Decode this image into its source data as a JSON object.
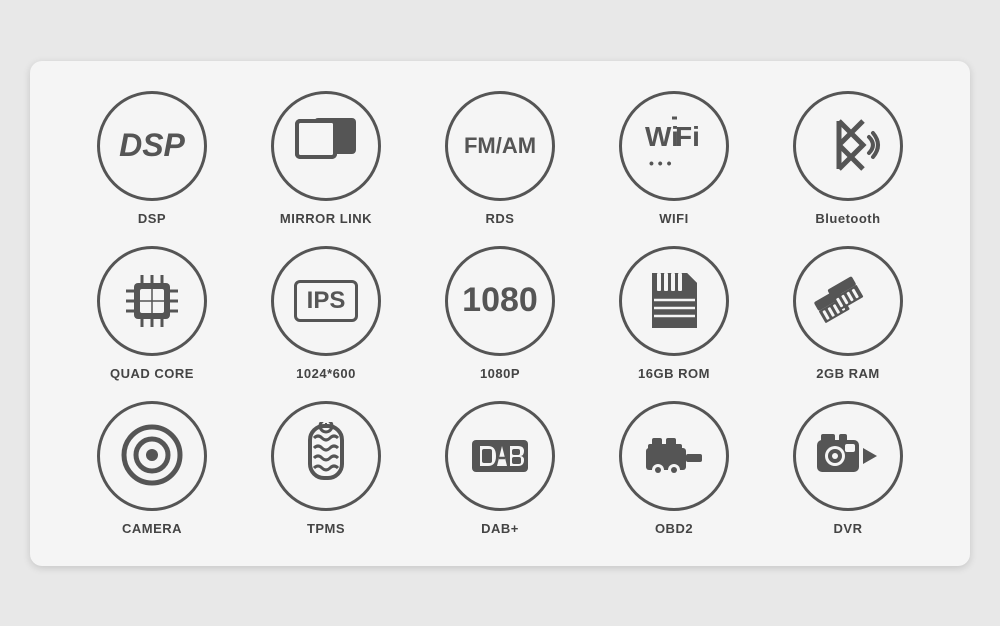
{
  "features": [
    {
      "id": "dsp",
      "label": "DSP",
      "row": 1
    },
    {
      "id": "mirror-link",
      "label": "MIRROR LINK",
      "row": 1
    },
    {
      "id": "rds",
      "label": "RDS",
      "row": 1
    },
    {
      "id": "wifi",
      "label": "WIFI",
      "row": 1
    },
    {
      "id": "bluetooth",
      "label": "Bluetooth",
      "row": 1
    },
    {
      "id": "quad-core",
      "label": "QUAD CORE",
      "row": 2
    },
    {
      "id": "ips",
      "label": "1024*600",
      "row": 2
    },
    {
      "id": "1080p",
      "label": "1080P",
      "row": 2
    },
    {
      "id": "16gb-rom",
      "label": "16GB ROM",
      "row": 2
    },
    {
      "id": "2gb-ram",
      "label": "2GB RAM",
      "row": 2
    },
    {
      "id": "camera",
      "label": "CAMERA",
      "row": 3
    },
    {
      "id": "tpms",
      "label": "TPMS",
      "row": 3
    },
    {
      "id": "dab",
      "label": "DAB+",
      "row": 3
    },
    {
      "id": "obd2",
      "label": "OBD2",
      "row": 3
    },
    {
      "id": "dvr",
      "label": "DVR",
      "row": 3
    }
  ]
}
